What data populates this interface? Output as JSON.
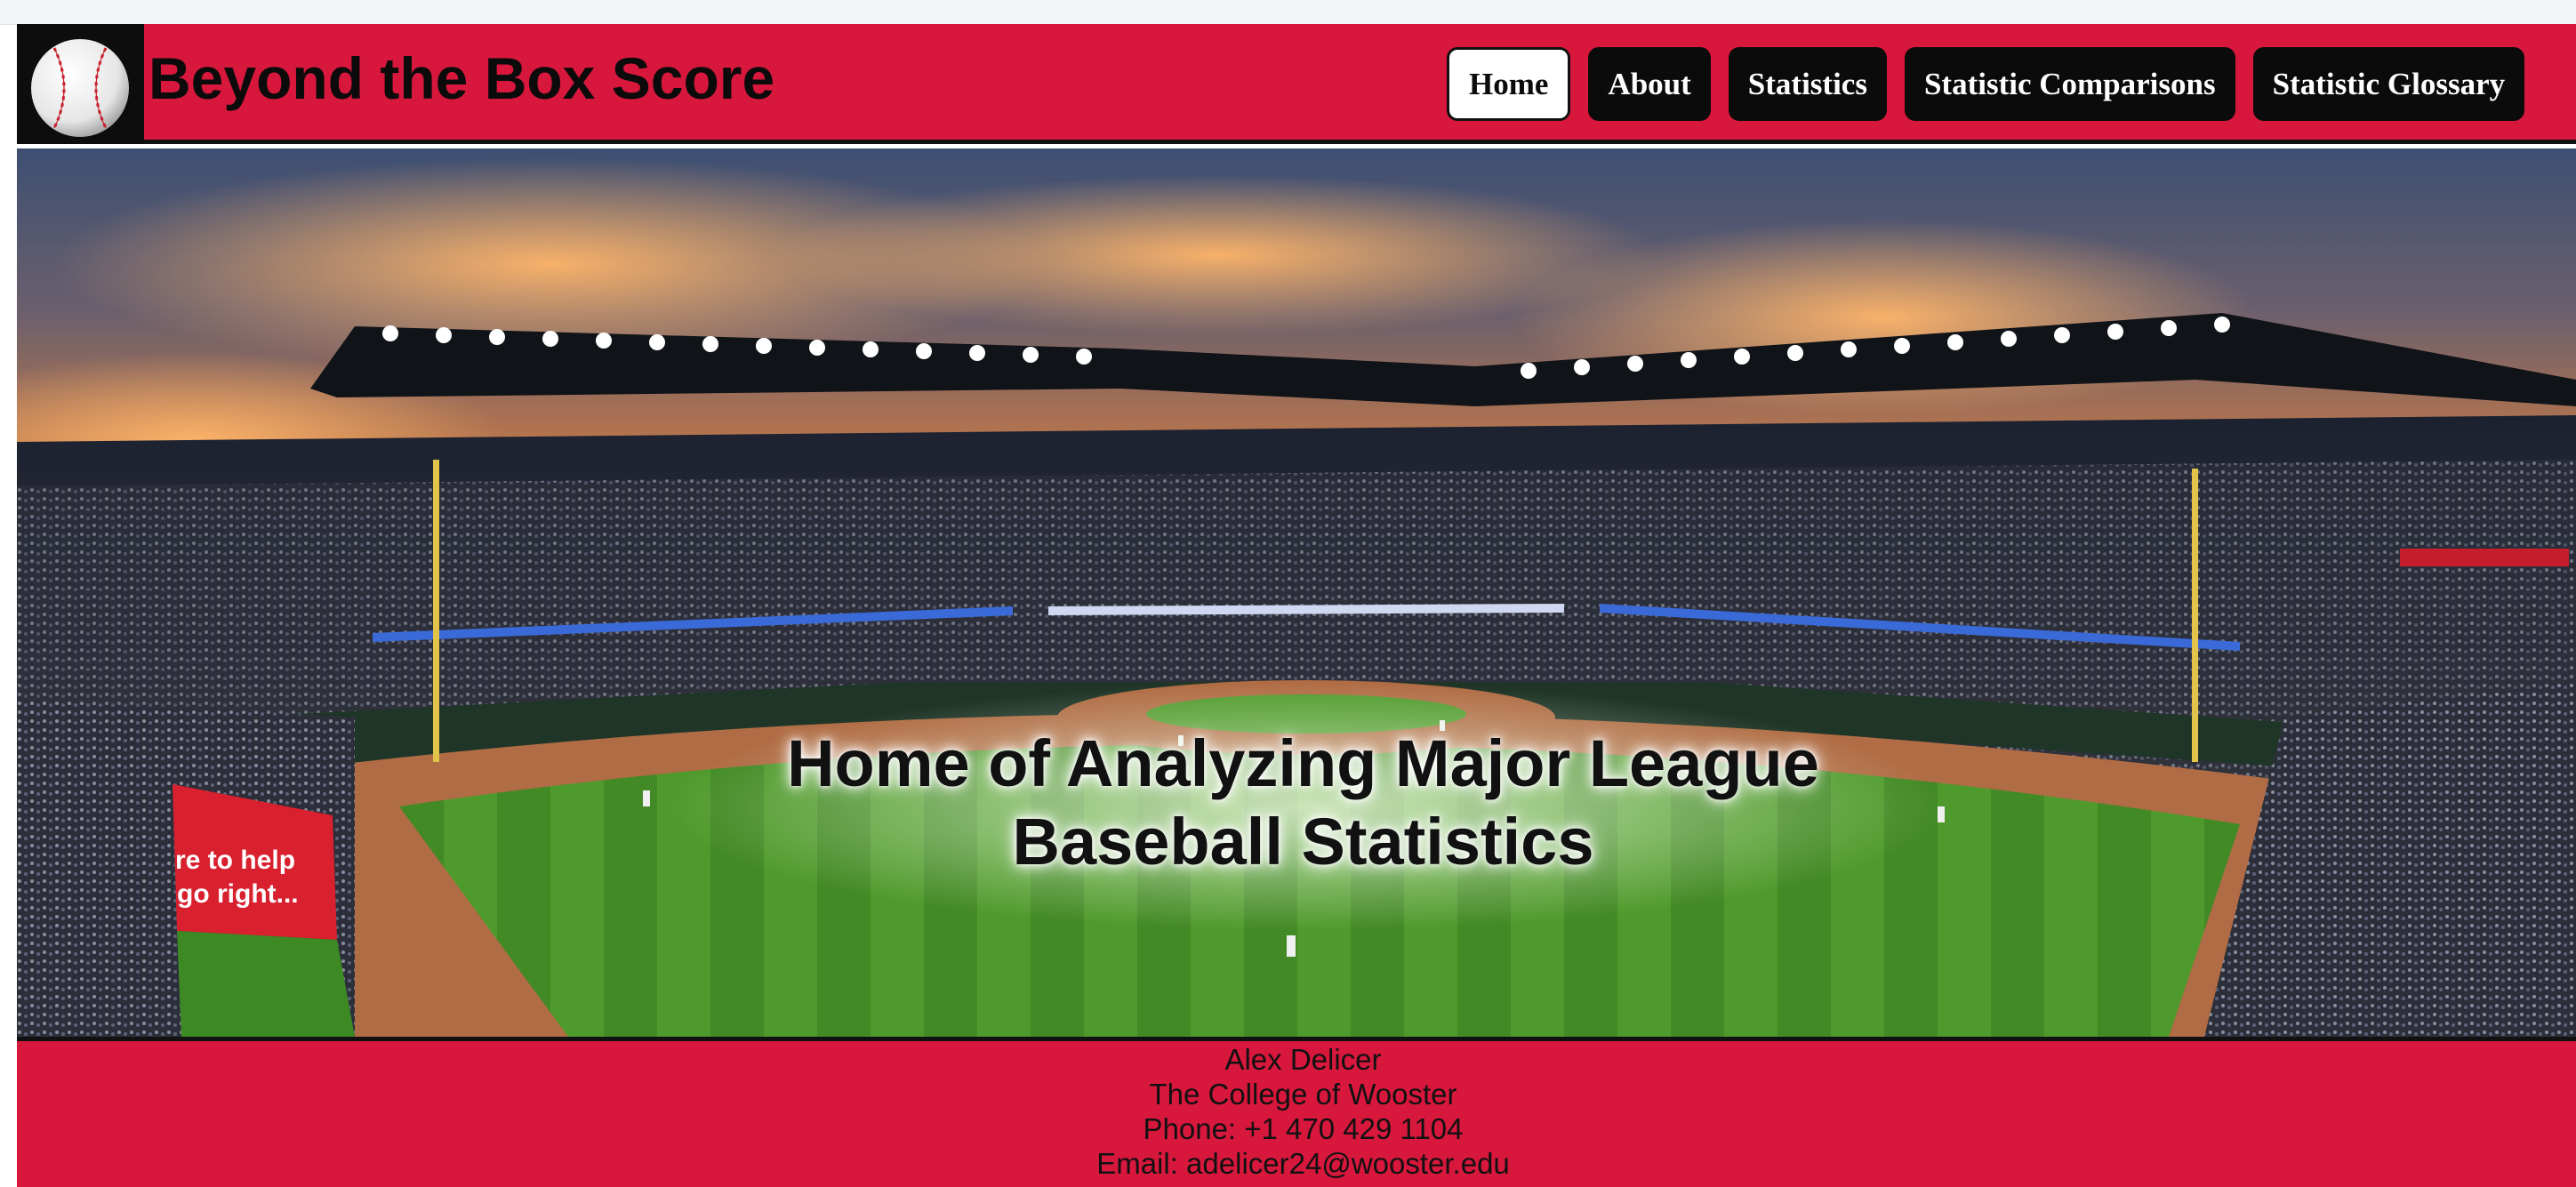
{
  "header": {
    "site_title": "Beyond the Box Score",
    "logo_icon": "baseball-icon",
    "background_color": "#d8173d"
  },
  "nav": {
    "items": [
      {
        "label": "Home",
        "active": true
      },
      {
        "label": "About",
        "active": false
      },
      {
        "label": "Statistics",
        "active": false
      },
      {
        "label": "Statistic Comparisons",
        "active": false
      },
      {
        "label": "Statistic Glossary",
        "active": false
      }
    ]
  },
  "hero": {
    "headline_line1": "Home of Analyzing Major League",
    "headline_line2": "Baseball Statistics",
    "image": "baseball-stadium-panorama-at-sunset",
    "banner_text_line1": "re to help",
    "banner_text_line2": "go right..."
  },
  "footer": {
    "name": "Alex Delicer",
    "school": "The College of Wooster",
    "phone": "Phone: +1 470 429 1104",
    "email": "Email: adelicer24@wooster.edu"
  }
}
